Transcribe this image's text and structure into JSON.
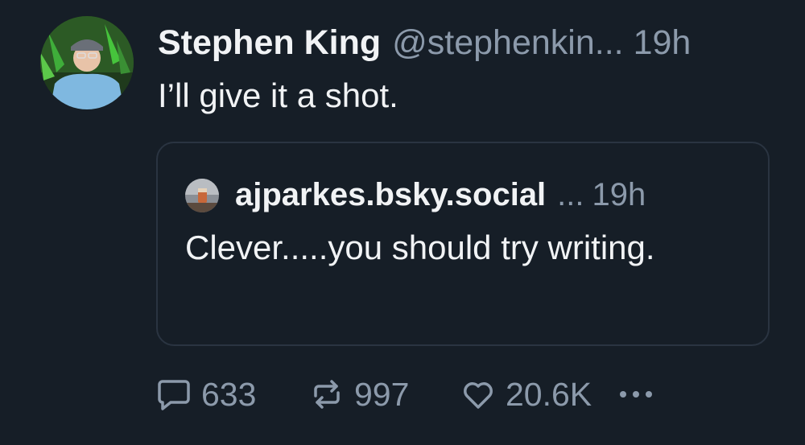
{
  "post": {
    "author_name": "Stephen King",
    "author_handle": "@stephenkin...",
    "time": "19h",
    "text": "I’ll give it a shot.",
    "avatar_icon": "profile-photo"
  },
  "quote": {
    "author": "ajparkes.bsky.social",
    "dots": "...",
    "time": "19h",
    "text": "Clever.....you should try writing.",
    "avatar_icon": "profile-photo"
  },
  "actions": {
    "reply_icon": "speech-bubble-icon",
    "reply_count": "633",
    "repost_icon": "repost-arrows-icon",
    "repost_count": "997",
    "like_icon": "heart-icon",
    "like_count": "20.6K",
    "more_icon": "ellipsis-icon"
  },
  "colors": {
    "background": "#161e27",
    "text_primary": "#f1f3f5",
    "text_secondary": "#8c9aab",
    "border": "#2a3441"
  }
}
